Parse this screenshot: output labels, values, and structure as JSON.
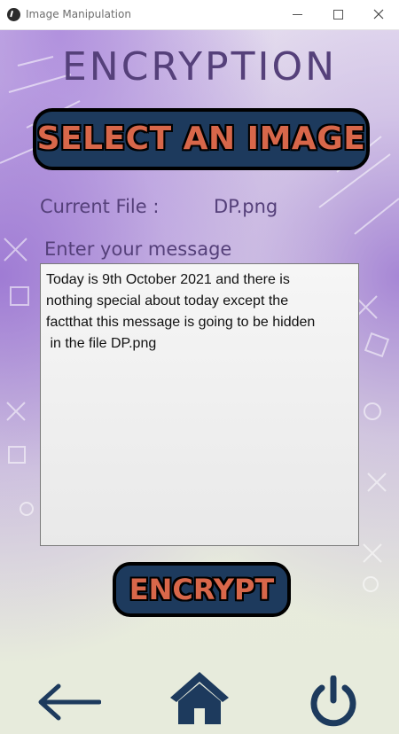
{
  "window": {
    "title": "Image Manipulation",
    "controls": {
      "minimize": "minimize-icon",
      "maximize": "maximize-icon",
      "close": "close-icon"
    }
  },
  "header": {
    "title": "ENCRYPTION"
  },
  "select_button": {
    "label": "SELECT AN IMAGE"
  },
  "current_file": {
    "label": "Current File :",
    "value": "DP.png"
  },
  "message": {
    "label": "Enter your message",
    "value": "Today is 9th October 2021 and there is\nnothing special about today except the\nfactthat this message is going to be hidden\n in the file DP.png"
  },
  "encrypt_button": {
    "label": "ENCRYPT"
  },
  "nav": {
    "back": "back-arrow-icon",
    "home": "home-icon",
    "power": "power-icon"
  },
  "colors": {
    "heading": "#55407a",
    "button_bg": "#1d3a5d",
    "button_text": "#d8674a",
    "nav_icon": "#1d3a5d"
  }
}
